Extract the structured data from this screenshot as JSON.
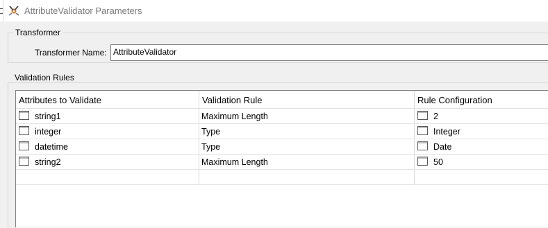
{
  "window": {
    "title": "AttributeValidator Parameters",
    "icon": "fme-transformer-icon"
  },
  "transformer_group": {
    "title": "Transformer",
    "name_label": "Transformer Name:",
    "name_value": "AttributeValidator"
  },
  "rules_group": {
    "title": "Validation Rules",
    "columns": [
      "Attributes to Validate",
      "Validation Rule",
      "Rule Configuration"
    ],
    "rows": [
      {
        "attribute": "string1",
        "rule": "Maximum Length",
        "config": "2"
      },
      {
        "attribute": "integer",
        "rule": "Type",
        "config": "Integer"
      },
      {
        "attribute": "datetime",
        "rule": "Type",
        "config": "Date"
      },
      {
        "attribute": "string2",
        "rule": "Maximum Length",
        "config": "50"
      },
      {
        "attribute": "",
        "rule": "",
        "config": ""
      }
    ]
  }
}
